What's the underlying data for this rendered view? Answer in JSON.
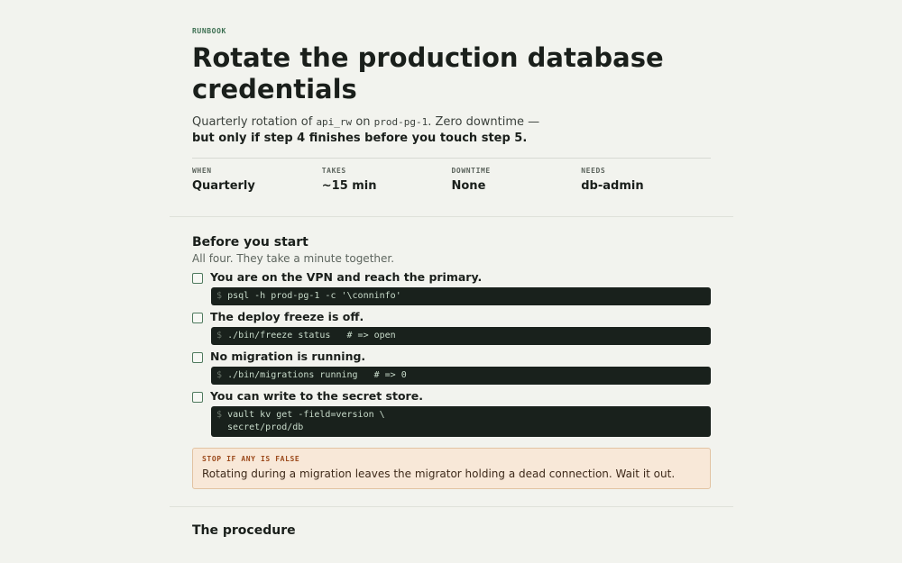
{
  "header": {
    "eyebrow": "RUNBOOK",
    "title": "Rotate the production database credentials",
    "lede_pre": "Quarterly rotation of ",
    "lede_code1": "api_rw",
    "lede_mid": " on ",
    "lede_code2": "prod-pg-1",
    "lede_post": ". Zero downtime —",
    "lede_strong": "but only if step 4 finishes before you touch step 5."
  },
  "meta": [
    {
      "key": "WHEN",
      "value": "Quarterly"
    },
    {
      "key": "TAKES",
      "value": "~15 min"
    },
    {
      "key": "DOWNTIME",
      "value": "None"
    },
    {
      "key": "NEEDS",
      "value": "db-admin"
    }
  ],
  "before": {
    "heading": "Before you start",
    "subtitle": "All four. They take a minute together.",
    "prompt": "$",
    "checks": [
      {
        "label": "You are on the VPN and reach the primary.",
        "code": "psql -h prod-pg-1 -c '\\conninfo'"
      },
      {
        "label": "The deploy freeze is off.",
        "code": "./bin/freeze status   # => open"
      },
      {
        "label": "No migration is running.",
        "code": "./bin/migrations running   # => 0"
      },
      {
        "label": "You can write to the secret store.",
        "code": "vault kv get -field=version \\\n  secret/prod/db"
      }
    ],
    "callout_title": "STOP IF ANY IS FALSE",
    "callout_body": "Rotating during a migration leaves the migrator holding a dead connection. Wait it out."
  },
  "procedure": {
    "heading": "The procedure"
  }
}
